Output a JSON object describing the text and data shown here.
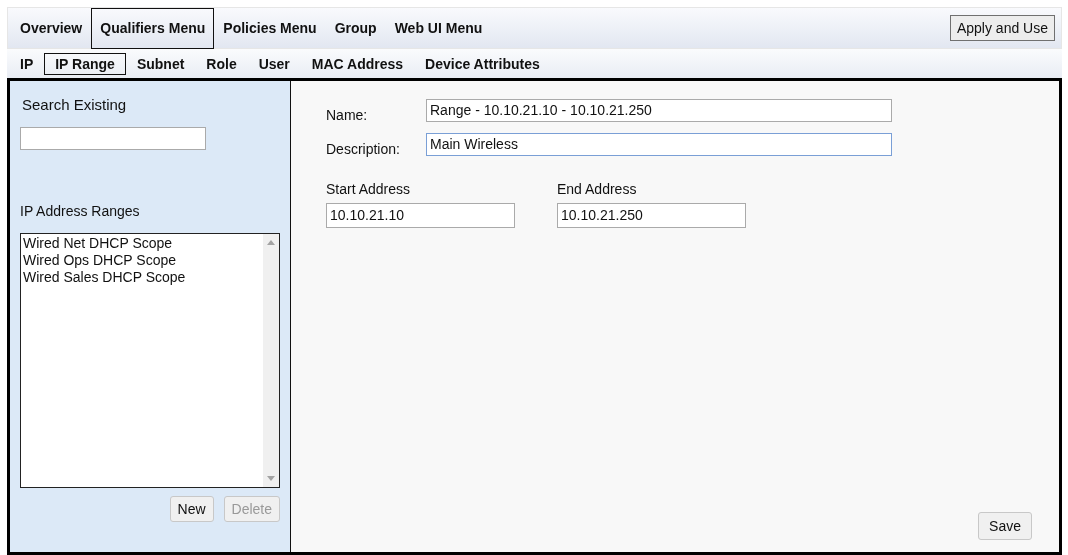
{
  "menu": [
    {
      "label": "Overview",
      "selected": false
    },
    {
      "label": "Qualifiers Menu",
      "selected": true
    },
    {
      "label": "Policies Menu",
      "selected": false
    },
    {
      "label": "Group",
      "selected": false
    },
    {
      "label": "Web UI Menu",
      "selected": false
    }
  ],
  "apply_button": "Apply and Use",
  "tabs": [
    {
      "label": "IP",
      "selected": false
    },
    {
      "label": "IP Range",
      "selected": true
    },
    {
      "label": "Subnet",
      "selected": false
    },
    {
      "label": "Role",
      "selected": false
    },
    {
      "label": "User",
      "selected": false
    },
    {
      "label": "MAC Address",
      "selected": false
    },
    {
      "label": "Device Attributes",
      "selected": false
    }
  ],
  "sidebar": {
    "search_label": "Search Existing",
    "list_label": "IP Address Ranges",
    "items": [
      "Wired Net DHCP Scope",
      "Wired Ops DHCP Scope",
      "Wired Sales DHCP Scope"
    ],
    "buttons": [
      {
        "label": "New",
        "disabled": false
      },
      {
        "label": "Delete",
        "disabled": true
      }
    ]
  },
  "form": {
    "name": {
      "label": "Name:",
      "value": "Range - 10.10.21.10 - 10.10.21.250",
      "focused": false
    },
    "description": {
      "label": "Description:",
      "value": "Main Wireless",
      "focused": true
    },
    "start": {
      "label": "Start Address",
      "value": "10.10.21.10"
    },
    "end": {
      "label": "End Address",
      "value": "10.10.21.250"
    },
    "save_button": "Save"
  }
}
